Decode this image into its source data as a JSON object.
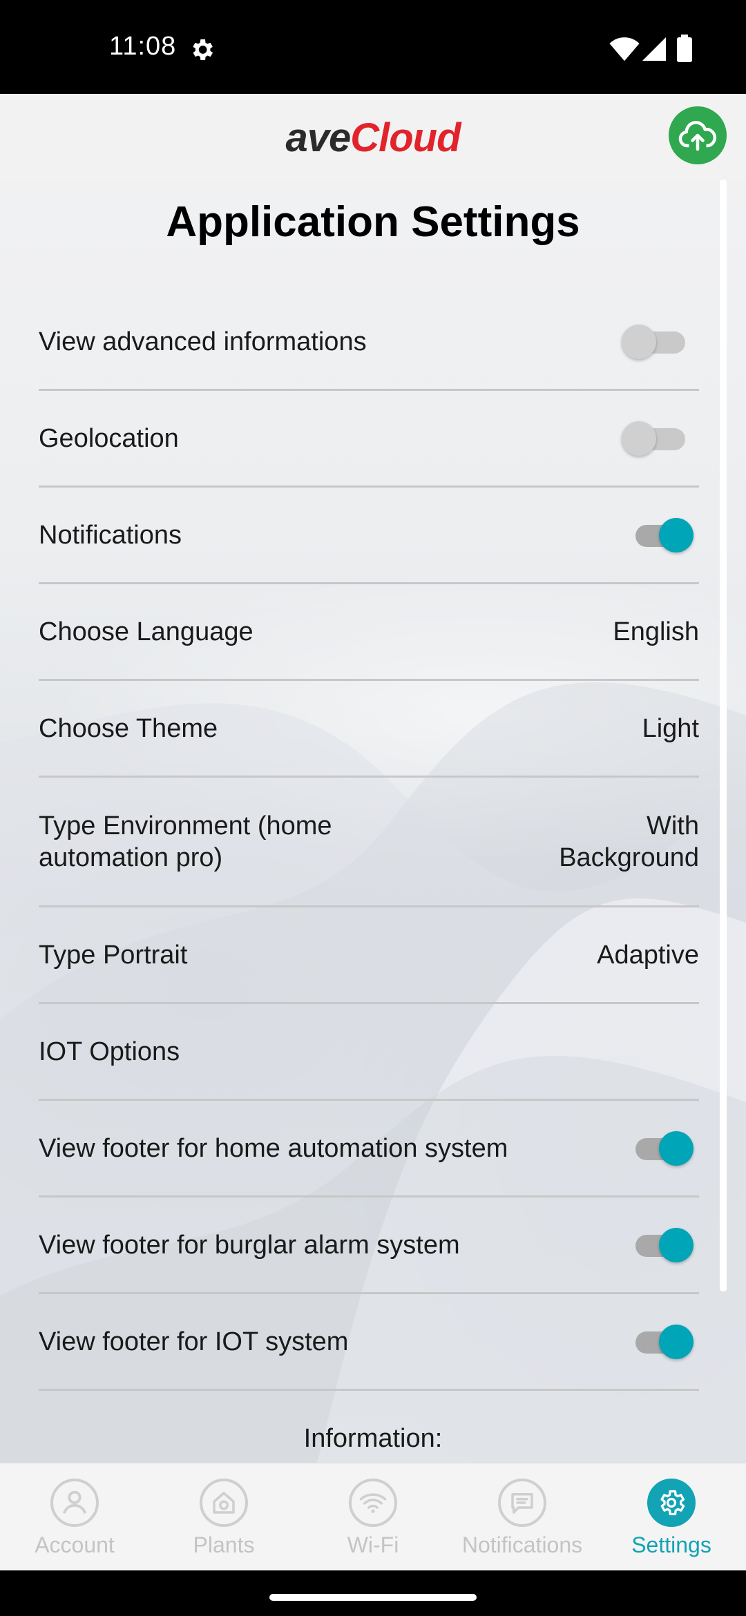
{
  "status_bar": {
    "time": "11:08",
    "icons": [
      "gear-icon",
      "wifi-icon",
      "cellular-icon",
      "battery-icon"
    ]
  },
  "header": {
    "logo_part1": "ave",
    "logo_part2": "Cloud",
    "upload_icon": "cloud-upload-icon",
    "colors": {
      "logo_dark": "#2b2b2b",
      "logo_red": "#e1242b",
      "upload_bg": "#2fa84f"
    }
  },
  "page": {
    "title": "Application Settings",
    "settings": [
      {
        "label": "View advanced informations",
        "type": "toggle",
        "on": false
      },
      {
        "label": "Geolocation",
        "type": "toggle",
        "on": false
      },
      {
        "label": "Notifications",
        "type": "toggle",
        "on": true
      },
      {
        "label": "Choose Language",
        "type": "value",
        "value": "English"
      },
      {
        "label": "Choose Theme",
        "type": "value",
        "value": "Light"
      },
      {
        "label": "Type Environment (home automation pro)",
        "type": "value",
        "value": "With Background"
      },
      {
        "label": "Type Portrait",
        "type": "value",
        "value": "Adaptive"
      },
      {
        "label": "IOT Options",
        "type": "none"
      },
      {
        "label": "View footer for home automation system",
        "type": "toggle",
        "on": true
      },
      {
        "label": "View footer for burglar alarm system",
        "type": "toggle",
        "on": true
      },
      {
        "label": "View footer for IOT system",
        "type": "toggle",
        "on": true
      }
    ],
    "info_label": "Information:",
    "accent_color": "#00a5b8"
  },
  "bottom_nav": {
    "items": [
      {
        "label": "Account",
        "icon": "account-icon",
        "active": false
      },
      {
        "label": "Plants",
        "icon": "plants-icon",
        "active": false
      },
      {
        "label": "Wi-Fi",
        "icon": "wifi-icon",
        "active": false
      },
      {
        "label": "Notifications",
        "icon": "notifications-icon",
        "active": false
      },
      {
        "label": "Settings",
        "icon": "settings-gear-icon",
        "active": true
      }
    ]
  }
}
